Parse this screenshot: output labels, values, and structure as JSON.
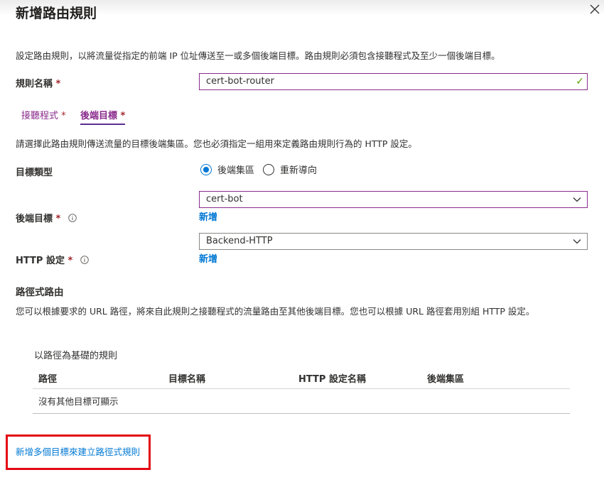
{
  "dialog": {
    "title": "新增路由規則",
    "description": "設定路由規則，以將流量從指定的前端 IP 位址傳送至一或多個後端目標。路由規則必須包含接聽程式及至少一個後端目標。"
  },
  "rule_name": {
    "label": "規則名稱",
    "required_mark": "*",
    "value": "cert-bot-router"
  },
  "tabs": [
    {
      "label": "接聽程式",
      "required_mark": "*"
    },
    {
      "label": "後端目標",
      "required_mark": "*",
      "selected": true
    }
  ],
  "backend": {
    "description": "請選擇此路由規則傳送流量的目標後端集區。您也必須指定一組用來定義路由規則行為的 HTTP 設定。",
    "target_type_label": "目標類型",
    "options": [
      {
        "label": "後端集區",
        "selected": true
      },
      {
        "label": "重新導向",
        "selected": false
      }
    ],
    "backend_target_label": "後端目標",
    "backend_target_required": "*",
    "backend_target_value": "cert-bot",
    "add_new_1": "新增",
    "http_settings_label": "HTTP 設定",
    "http_settings_required": "*",
    "http_settings_value": "Backend-HTTP",
    "add_new_2": "新增"
  },
  "path_routing": {
    "heading": "路徑式路由",
    "description": "您可以根據要求的 URL 路徑，將來自此規則之接聽程式的流量路由至其他後端目標。您也可以根據 URL 路徑套用別組 HTTP 設定。",
    "table_title": "以路徑為基礎的規則",
    "columns": [
      "路徑",
      "目標名稱",
      "HTTP 設定名稱",
      "後端集區"
    ],
    "empty_message": "沒有其他目標可顯示",
    "add_multiple_link": "新增多個目標來建立路徑式規則"
  },
  "colors": {
    "accent": "#0078d4",
    "focus_border": "#8a2b8c",
    "highlight_box": "#e30613",
    "required": "#a4262c"
  }
}
